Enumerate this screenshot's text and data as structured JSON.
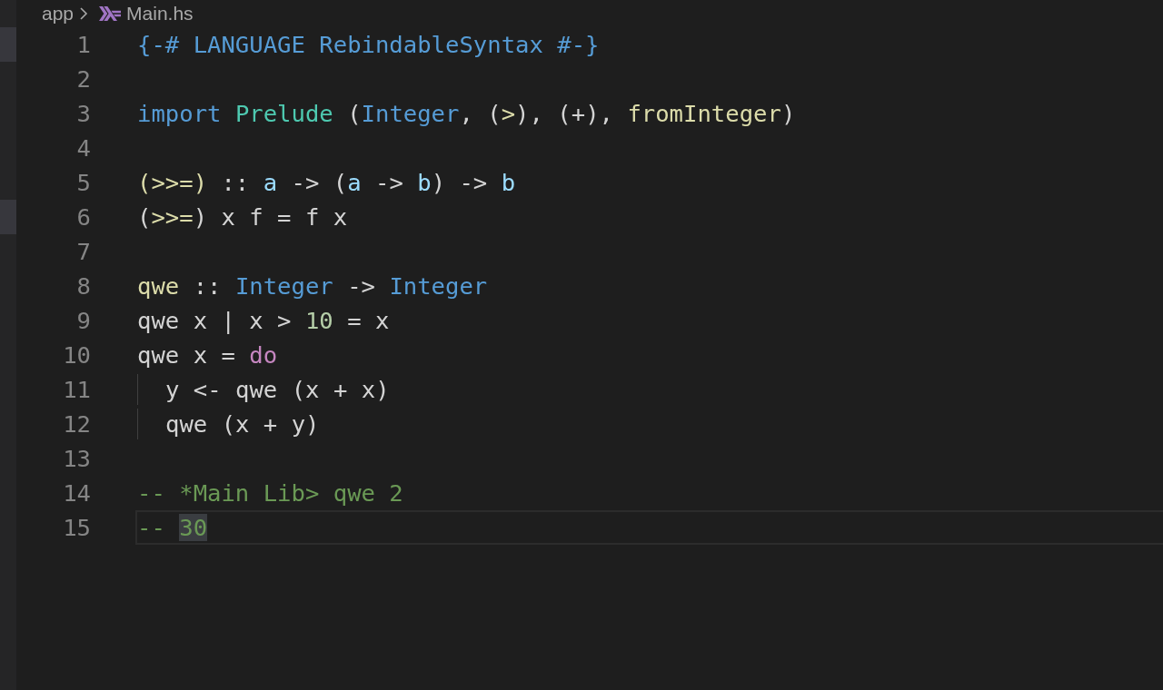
{
  "breadcrumb": {
    "folder": "app",
    "file": "Main.hs"
  },
  "lines": [
    {
      "number": "1",
      "gutter_mark": true,
      "tokens": [
        {
          "kind": "pragma",
          "text": "{-# LANGUAGE RebindableSyntax #-}"
        }
      ]
    },
    {
      "number": "2"
    },
    {
      "number": "3",
      "tokens": [
        {
          "kind": "keyword",
          "text": "import "
        },
        {
          "kind": "module",
          "text": "Prelude"
        },
        {
          "kind": "plain",
          "text": " ("
        },
        {
          "kind": "type",
          "text": "Integer"
        },
        {
          "kind": "plain",
          "text": ", ("
        },
        {
          "kind": "func",
          "text": ">"
        },
        {
          "kind": "plain",
          "text": "), (+), "
        },
        {
          "kind": "func",
          "text": "fromInteger"
        },
        {
          "kind": "plain",
          "text": ")"
        }
      ]
    },
    {
      "number": "4"
    },
    {
      "number": "5",
      "tokens": [
        {
          "kind": "func",
          "text": "(>>=)"
        },
        {
          "kind": "plain",
          "text": " :: "
        },
        {
          "kind": "var",
          "text": "a"
        },
        {
          "kind": "plain",
          "text": " -> ("
        },
        {
          "kind": "var",
          "text": "a"
        },
        {
          "kind": "plain",
          "text": " -> "
        },
        {
          "kind": "var",
          "text": "b"
        },
        {
          "kind": "plain",
          "text": ") -> "
        },
        {
          "kind": "var",
          "text": "b"
        }
      ]
    },
    {
      "number": "6",
      "gutter_mark": true,
      "tokens": [
        {
          "kind": "plain",
          "text": "("
        },
        {
          "kind": "func",
          "text": ">>="
        },
        {
          "kind": "plain",
          "text": ") x f = f x"
        }
      ]
    },
    {
      "number": "7"
    },
    {
      "number": "8",
      "tokens": [
        {
          "kind": "func",
          "text": "qwe"
        },
        {
          "kind": "plain",
          "text": " :: "
        },
        {
          "kind": "type",
          "text": "Integer"
        },
        {
          "kind": "plain",
          "text": " -> "
        },
        {
          "kind": "type",
          "text": "Integer"
        }
      ]
    },
    {
      "number": "9",
      "tokens": [
        {
          "kind": "plain",
          "text": "qwe x | x > "
        },
        {
          "kind": "number",
          "text": "10"
        },
        {
          "kind": "plain",
          "text": " = x"
        }
      ]
    },
    {
      "number": "10",
      "tokens": [
        {
          "kind": "plain",
          "text": "qwe x = "
        },
        {
          "kind": "control",
          "text": "do"
        }
      ]
    },
    {
      "number": "11",
      "indent_guide": true,
      "tokens": [
        {
          "kind": "plain",
          "text": "y <- qwe (x + x)"
        }
      ]
    },
    {
      "number": "12",
      "indent_guide": true,
      "tokens": [
        {
          "kind": "plain",
          "text": "qwe (x + y)"
        }
      ]
    },
    {
      "number": "13"
    },
    {
      "number": "14",
      "tokens": [
        {
          "kind": "comment",
          "text": "-- *Main Lib> qwe 2"
        }
      ]
    },
    {
      "number": "15",
      "current": true,
      "tokens": [
        {
          "kind": "comment",
          "text": "-- "
        },
        {
          "kind": "comment",
          "text": "30",
          "highlight": true
        }
      ]
    }
  ]
}
